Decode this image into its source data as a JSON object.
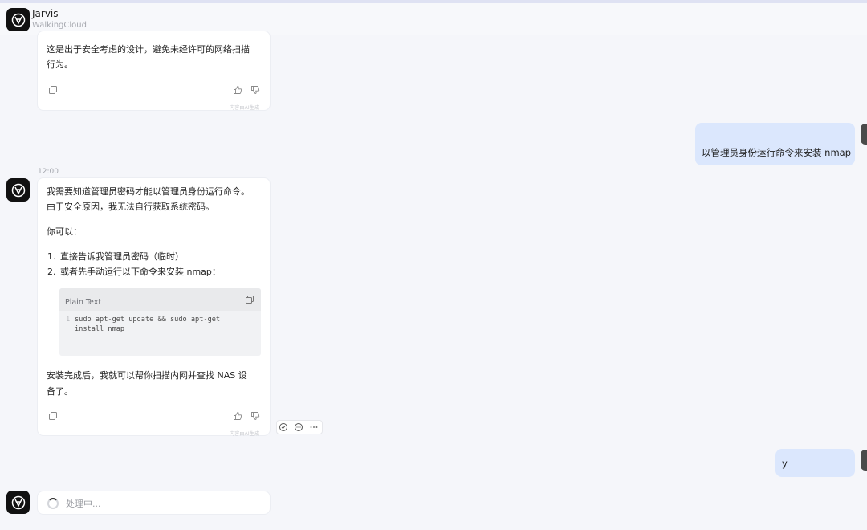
{
  "header": {
    "title": "Jarvis",
    "subtitle": "WalkingCloud"
  },
  "messages": {
    "first_ai": {
      "text_line1": "这是出于安全考虑的设计，避免未经许可的网络扫描",
      "text_line2": "行为。",
      "ai_note": "内容由AI生成"
    },
    "user_1": {
      "text": "以管理员身份运行命令来安装 nmap"
    },
    "timestamp": "12:00",
    "second_ai": {
      "line1": "我需要知道管理员密码才能以管理员身份运行命令。",
      "line2": "由于安全原因，我无法自行获取系统密码。",
      "line3": "你可以：",
      "list": [
        {
          "num": "1.",
          "text": "直接告诉我管理员密码（临时）"
        },
        {
          "num": "2.",
          "text": "或者先手动运行以下命令来安装 nmap："
        }
      ],
      "code": {
        "lang": "Plain Text",
        "line_no": "1",
        "line1": "sudo apt-get update && sudo apt-get",
        "line2": "install nmap"
      },
      "after_line1": "安装完成后，我就可以帮你扫描内网并查找 NAS 设",
      "after_line2": "备了。",
      "ai_note": "内容由AI生成"
    },
    "user_2": {
      "text": "y"
    },
    "loading": {
      "text": "处理中..."
    }
  },
  "icons": {
    "copy": "copy-icon",
    "thumb_up": "thumb-up-icon",
    "thumb_down": "thumb-down-icon",
    "more": "more-icon"
  },
  "colors": {
    "user_bubble": "#dbe7fd",
    "background": "#f5f6fa"
  }
}
